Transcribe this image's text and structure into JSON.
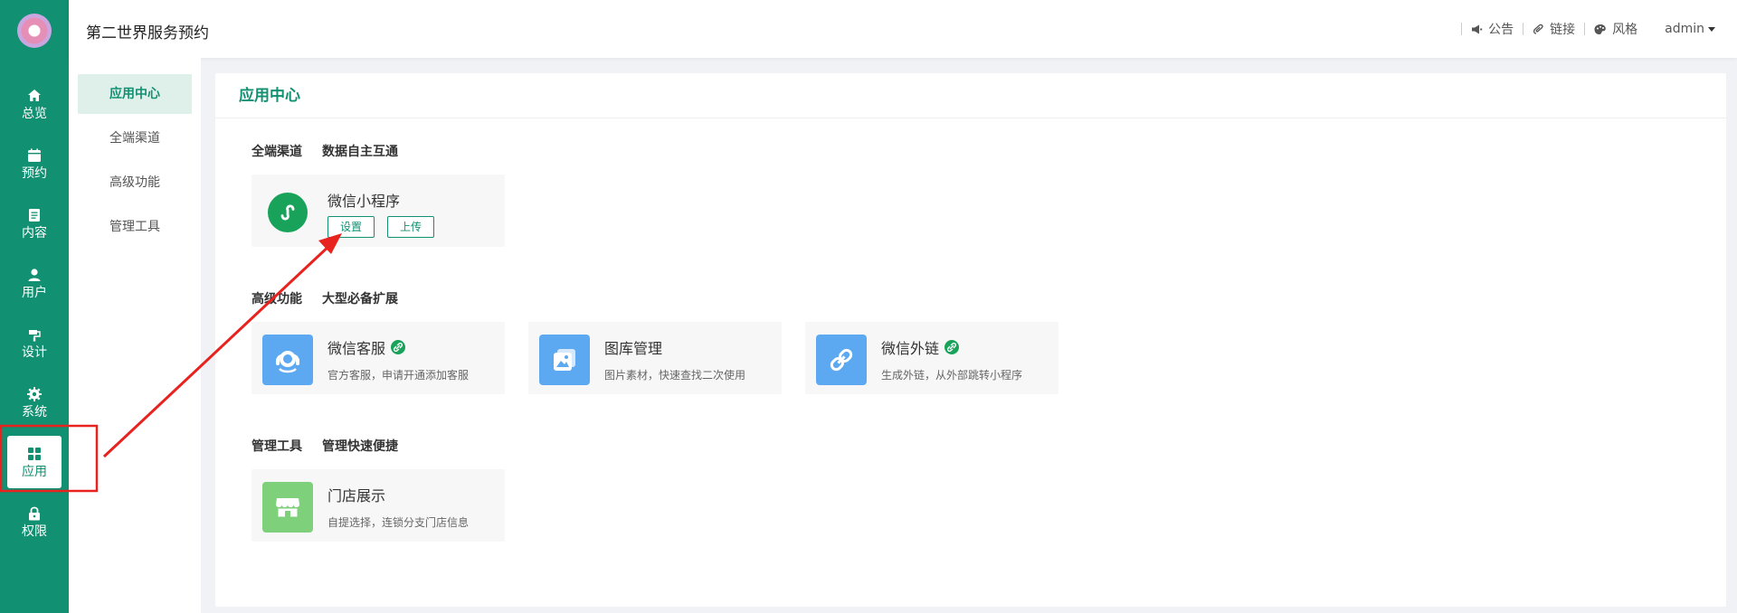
{
  "app": {
    "title": "第二世界服务预约"
  },
  "rail": {
    "items": [
      {
        "label": "总览",
        "icon": "home-icon"
      },
      {
        "label": "预约",
        "icon": "calendar-icon"
      },
      {
        "label": "内容",
        "icon": "document-icon"
      },
      {
        "label": "用户",
        "icon": "user-icon"
      },
      {
        "label": "设计",
        "icon": "paint-icon"
      },
      {
        "label": "系统",
        "icon": "gear-icon"
      },
      {
        "label": "应用",
        "icon": "grid-icon",
        "active": true
      },
      {
        "label": "权限",
        "icon": "lock-icon"
      }
    ]
  },
  "subnav": {
    "items": [
      {
        "label": "应用中心",
        "active": true
      },
      {
        "label": "全端渠道"
      },
      {
        "label": "高级功能"
      },
      {
        "label": "管理工具"
      }
    ]
  },
  "header": {
    "links": [
      {
        "label": "公告",
        "icon": "megaphone-icon"
      },
      {
        "label": "链接",
        "icon": "paperclip-icon"
      },
      {
        "label": "风格",
        "icon": "palette-icon"
      }
    ],
    "user": "admin"
  },
  "main": {
    "title": "应用中心",
    "sections": [
      {
        "title": "全端渠道",
        "subtitle": "数据自主互通",
        "cards": [
          {
            "name": "微信小程序",
            "icon": "mini-program-icon",
            "buttons": [
              "设置",
              "上传"
            ]
          }
        ]
      },
      {
        "title": "高级功能",
        "subtitle": "大型必备扩展",
        "cards": [
          {
            "name": "微信客服",
            "icon": "customer-service-icon",
            "badge": "link-badge-icon",
            "desc": "官方客服，申请开通添加客服"
          },
          {
            "name": "图库管理",
            "icon": "gallery-icon",
            "desc": "图片素材，快速查找二次使用"
          },
          {
            "name": "微信外链",
            "icon": "chain-link-icon",
            "badge": "link-badge-icon",
            "desc": "生成外链，从外部跳转小程序"
          }
        ]
      },
      {
        "title": "管理工具",
        "subtitle": "管理快速便捷",
        "cards": [
          {
            "name": "门店展示",
            "icon": "store-icon",
            "desc": "自提选择，连锁分支门店信息"
          }
        ]
      }
    ]
  },
  "colors": {
    "accent": "#129072",
    "highlight": "#e8231f",
    "icon_blue": "#5ca9f2",
    "icon_green": "#7ed07a",
    "badge_green": "#19a35a"
  }
}
